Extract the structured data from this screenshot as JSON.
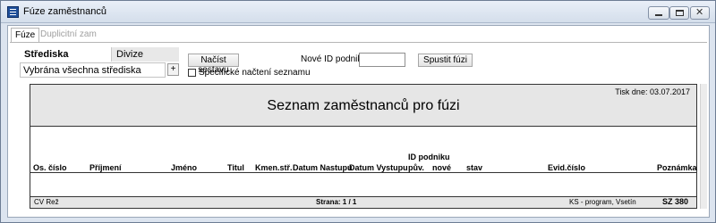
{
  "window": {
    "title": "Fúze zaměstnanců",
    "icon": "table-icon"
  },
  "tabs": [
    "Fúze",
    "Duplicitní zam"
  ],
  "filter": {
    "segments": [
      "Střediska",
      "Divize"
    ],
    "selected_segment": "Střediska",
    "selection_text": "Vybrána všechna střediska",
    "add_button": "+"
  },
  "actions": {
    "load_label": "Načíst sestavu",
    "specific_label": "Specifické načtení seznamu",
    "specific_checked": false,
    "new_id_label": "Nové ID podniku:",
    "new_id_value": "",
    "run_label": "Spustit fúzi"
  },
  "report": {
    "print_date": "Tisk dne: 03.07.2017",
    "title": "Seznam zaměstnanců pro fúzi",
    "columns": {
      "cislo": "Os. číslo",
      "prijmeni": "Příjmení",
      "jmeno": "Jméno",
      "titul": "Titul",
      "kmen": "Kmen.stř.",
      "nastup": "Datum Nastupu",
      "vystup": "Datum Vystupu",
      "id_podniku": "ID podniku",
      "puv": "pův.",
      "nove": "nové",
      "stav": "stav",
      "evid": "Evid.číslo",
      "poznamka": "Poznámka"
    },
    "rows": [],
    "footer": {
      "author": "CV Rež",
      "page": "Strana: 1 / 1",
      "company": "KS - program, Vsetín",
      "code": "SZ 380"
    }
  }
}
